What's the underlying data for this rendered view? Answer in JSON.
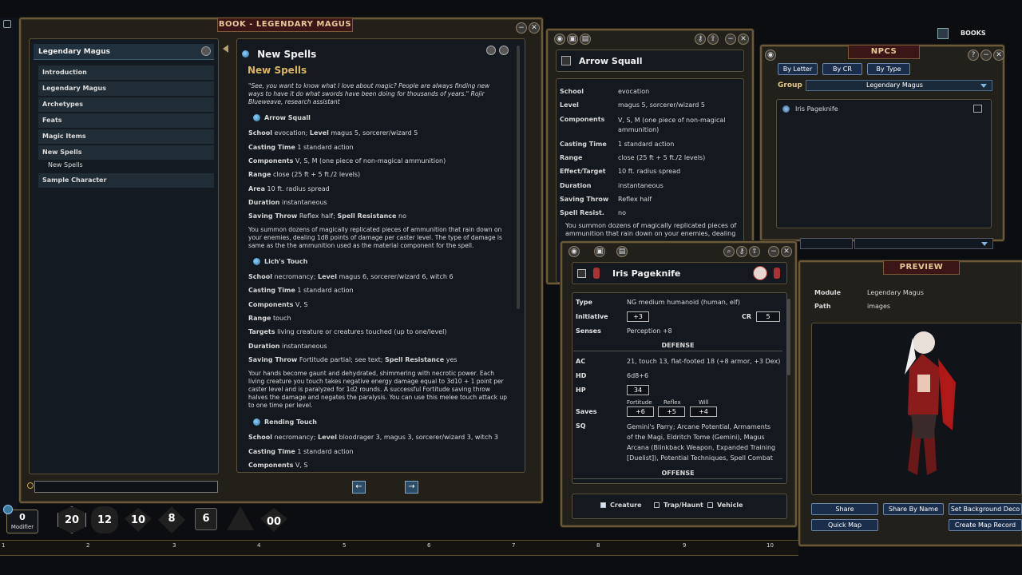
{
  "top_bar": {
    "books_label": "BOOKS"
  },
  "book_window": {
    "title": "BOOK - LEGENDARY MAGUS",
    "sidebar": {
      "header": "Legendary Magus",
      "items": [
        {
          "label": "Introduction"
        },
        {
          "label": "Legendary Magus"
        },
        {
          "label": "Archetypes"
        },
        {
          "label": "Feats"
        },
        {
          "label": "Magic Items"
        },
        {
          "label": "New Spells"
        },
        {
          "label": "New Spells"
        },
        {
          "label": "Sample Character"
        }
      ]
    },
    "content": {
      "page_title": "New Spells",
      "section_heading": "New Spells",
      "quote": "\"See, you want to know what I love about magic? People are always finding new ways to have it do what swords have been doing for thousands of years.\" Rojir Blueweave, research assistant",
      "spell1": {
        "name": "Arrow Squall",
        "school_label": "School",
        "school": "evocation;",
        "level_label": "Level",
        "level": "magus 5, sorcerer/wizard 5",
        "casting_label": "Casting Time",
        "casting": "1 standard action",
        "components_label": "Components",
        "components": "V, S, M (one piece of non-magical ammunition)",
        "range_label": "Range",
        "range": "close (25 ft + 5 ft./2 levels)",
        "area_label": "Area",
        "area": "10 ft. radius spread",
        "duration_label": "Duration",
        "duration": "instantaneous",
        "save_label": "Saving Throw",
        "save": "Reflex half;",
        "sr_label": "Spell Resistance",
        "sr": "no",
        "desc": "You summon dozens of magically replicated pieces of ammunition that rain down on your enemies, dealing 1d8 points of damage per caster level. The type of damage is same as the the ammunition used as the material component for the spell."
      },
      "spell2": {
        "name": "Lich's Touch",
        "school_label": "School",
        "school": "necromancy;",
        "level_label": "Level",
        "level": "magus 6, sorcerer/wizard 6, witch 6",
        "casting_label": "Casting Time",
        "casting": "1 standard action",
        "components_label": "Components",
        "components": "V, S",
        "range_label": "Range",
        "range": "touch",
        "targets_label": "Targets",
        "targets": "living creature or creatures touched (up to one/level)",
        "duration_label": "Duration",
        "duration": "instantaneous",
        "save_label": "Saving Throw",
        "save": "Fortitude partial; see text;",
        "sr_label": "Spell Resistance",
        "sr": "yes",
        "desc": "Your hands become gaunt and dehydrated, shimmering with necrotic power. Each living creature you touch takes negative energy damage equal to 3d10 + 1 point per caster level and is paralyzed for 1d2 rounds. A successful Fortitude saving throw halves the damage and negates the paralysis. You can use this melee touch attack up to one time per level."
      },
      "spell3": {
        "name": "Rending Touch",
        "school_label": "School",
        "school": "necromancy;",
        "level_label": "Level",
        "level": "bloodrager 3, magus 3, sorcerer/wizard 3, witch 3",
        "casting_label": "Casting Time",
        "casting": "1 standard action",
        "components_label": "Components",
        "components": "V, S"
      }
    }
  },
  "arrow_window": {
    "title": "Arrow Squall",
    "fields": [
      {
        "label": "School",
        "value": "evocation"
      },
      {
        "label": "Level",
        "value": "magus 5, sorcerer/wizard 5"
      },
      {
        "label": "Components",
        "value": "V, S, M (one piece of non-magical ammunition)"
      },
      {
        "label": "Casting Time",
        "value": "1 standard action"
      },
      {
        "label": "Range",
        "value": "close (25 ft + 5 ft./2 levels)"
      },
      {
        "label": "Effect/Target",
        "value": "10 ft. radius spread"
      },
      {
        "label": "Duration",
        "value": "instantaneous"
      },
      {
        "label": "Saving Throw",
        "value": "Reflex half"
      },
      {
        "label": "Spell Resist.",
        "value": "no"
      }
    ],
    "desc": "You summon dozens of magically replicated pieces of ammunition that rain down on your enemies, dealing"
  },
  "npcs_window": {
    "title": "NPCS",
    "buttons": [
      "By Letter",
      "By CR",
      "By Type"
    ],
    "group_label": "Group",
    "group_value": "Legendary Magus",
    "items": [
      {
        "name": "Iris Pageknife"
      }
    ]
  },
  "iris_window": {
    "title": "Iris Pageknife",
    "type_label": "Type",
    "type": "NG medium humanoid (human, elf)",
    "init_label": "Initiative",
    "init": "+3",
    "cr_label": "CR",
    "cr": "5",
    "senses_label": "Senses",
    "senses": "Perception +8",
    "defense_header": "DEFENSE",
    "ac_label": "AC",
    "ac": "21, touch 13, flat-footed 18 (+8 armor, +3 Dex)",
    "hd_label": "HD",
    "hd": "6d8+6",
    "hp_label": "HP",
    "hp": "34",
    "fort_label": "Fortitude",
    "fort": "+6",
    "ref_label": "Reflex",
    "ref": "+5",
    "will_label": "Will",
    "will": "+4",
    "saves_label": "Saves",
    "sq_label": "SQ",
    "sq": "Gemini's Parry; Arcane Potential, Armaments of the Magi, Eldritch Tome (Gemini), Magus Arcana (Blinkback Weapon, Expanded Training [Duelist]), Potential Techniques, Spell Combat",
    "offense_header": "OFFENSE",
    "radio": [
      "Creature",
      "Trap/Haunt",
      "Vehicle"
    ]
  },
  "preview_window": {
    "title": "PREVIEW",
    "module_label": "Module",
    "module": "Legendary Magus",
    "path_label": "Path",
    "path": "images",
    "buttons": [
      "Share",
      "Share By Name",
      "Set Background Deco",
      "Quick Map",
      "Create Map Record"
    ]
  },
  "dice": {
    "modifier_value": "0",
    "modifier_label": "Modifier",
    "labels": [
      "20",
      "12",
      "10",
      "8",
      "6",
      "",
      "00"
    ]
  },
  "hotbar": {
    "numbers": [
      "1",
      "2",
      "3",
      "4",
      "5",
      "6",
      "7",
      "8",
      "9",
      "10"
    ]
  }
}
